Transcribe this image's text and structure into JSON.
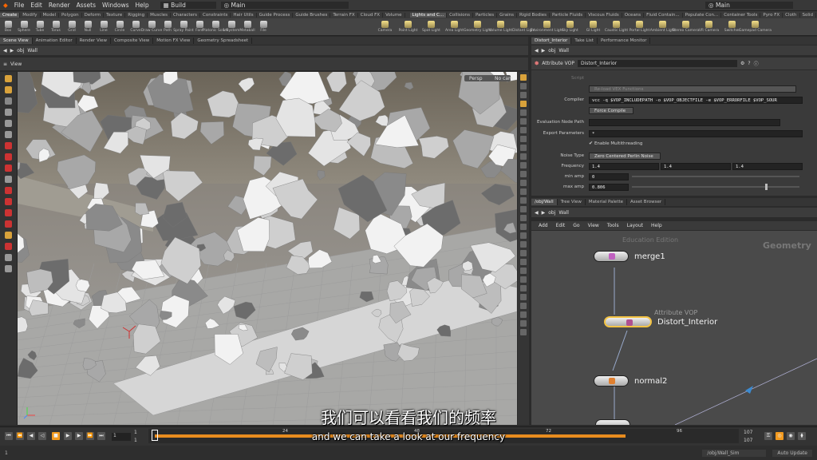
{
  "menu": {
    "items": [
      "File",
      "Edit",
      "Render",
      "Assets",
      "Windows",
      "Help"
    ],
    "desktop": "Build",
    "main_left": "Main",
    "main_right": "Main"
  },
  "shelf_tabs": [
    "Create",
    "Modify",
    "Model",
    "Polygon",
    "Deform",
    "Texture",
    "Rigging",
    "Muscles",
    "Characters",
    "Constraints",
    "Hair Utils",
    "Guide Process",
    "Guide Brushes",
    "Terrain FX",
    "Cloud FX",
    "Volume"
  ],
  "shelf_tabs_right": [
    "Lights and C...",
    "Collisions",
    "Particles",
    "Grains",
    "Rigid Bodies",
    "Particle Fluids",
    "Viscous Fluids",
    "Oceans",
    "Fluid Contain...",
    "Populate Con...",
    "Container Tools",
    "Pyro FX",
    "Cloth",
    "Solid",
    "Wires",
    "Crowds",
    "Drive Simula..."
  ],
  "shelf_tools": [
    "Box",
    "Sphere",
    "Tube",
    "Torus",
    "Grid",
    "Null",
    "Line",
    "Circle",
    "Curve",
    "Draw Curve",
    "Path",
    "Spray Paint",
    "Font",
    "Platonic Solids",
    "L-System",
    "Metaball",
    "File"
  ],
  "shelf_tools_right": [
    "Camera",
    "Point Light",
    "Spot Light",
    "Area Light",
    "Geometry Light",
    "Volume Light",
    "Distant Light",
    "Environment Light",
    "Sky Light",
    "GI Light",
    "Caustic Light",
    "Portal Light",
    "Ambient Light",
    "Stereo Camera",
    "VR Camera",
    "Switcher",
    "Gamepad Camera"
  ],
  "left_tabs": [
    "Scene View",
    "Animation Editor",
    "Render View",
    "Composite View",
    "Motion FX View",
    "Geometry Spreadsheet"
  ],
  "left_path": [
    "obj",
    "Wall"
  ],
  "viewport": {
    "label": "View",
    "overlay": "Persp",
    "cam": "No cam"
  },
  "param_tabs": [
    "Distort_Interior",
    "Take List",
    "Performance Monitor"
  ],
  "param_path": [
    "obj",
    "Wall"
  ],
  "param_header": {
    "type": "Attribute VOP",
    "name": "Distort_Interior"
  },
  "params": {
    "script_label": "Script",
    "reload_label": "Re-load VEX Functions",
    "compiler_label": "Compiler",
    "compiler_value": "vcc -q $VOP_INCLUDEPATH -o $VOP_OBJECTFILE -e $VOP_ERRORFILE $VOP_SOUR",
    "force_compile": "Force Compile",
    "eval_label": "Evaluation Node Path",
    "export_label": "Export Parameters",
    "export_value": "*",
    "multithread": "Enable Multithreading",
    "noise_type_label": "Noise Type",
    "noise_type_value": "Zero Centered Perlin Noise",
    "frequency_label": "Frequency",
    "frequency": [
      "1.4",
      "1.4",
      "1.4"
    ],
    "minamp_label": "min amp",
    "minamp": "0",
    "maxamp_label": "max amp",
    "maxamp": "0.806",
    "maxamp_level": 0.806
  },
  "network_tabs": [
    "/obj/Wall",
    "Tree View",
    "Material Palette",
    "Asset Browser"
  ],
  "network_path": [
    "obj",
    "Wall"
  ],
  "network_menu": [
    "Add",
    "Edit",
    "Go",
    "View",
    "Tools",
    "Layout",
    "Help"
  ],
  "network": {
    "watermark_edu": "Education Edition",
    "watermark_context": "Geometry",
    "vop_type": "Attribute VOP"
  },
  "nodes": [
    {
      "name": "merge1",
      "color": "#c060c0"
    },
    {
      "name": "Distort_Interior",
      "color": "#b05090"
    },
    {
      "name": "normal2",
      "color": "#e08030"
    }
  ],
  "timeline": {
    "frame": "1",
    "start": "1",
    "ticks": [
      "24",
      "48",
      "72",
      "96"
    ],
    "end1": "107",
    "end2": "107",
    "start2": "1",
    "start3": "1"
  },
  "status": {
    "path": "/obj/Wall_Sim",
    "auto_update": "Auto Update"
  },
  "subtitles": {
    "zh": "我们可以看看我们的频率",
    "en": "and we can take a look at our frequency"
  }
}
